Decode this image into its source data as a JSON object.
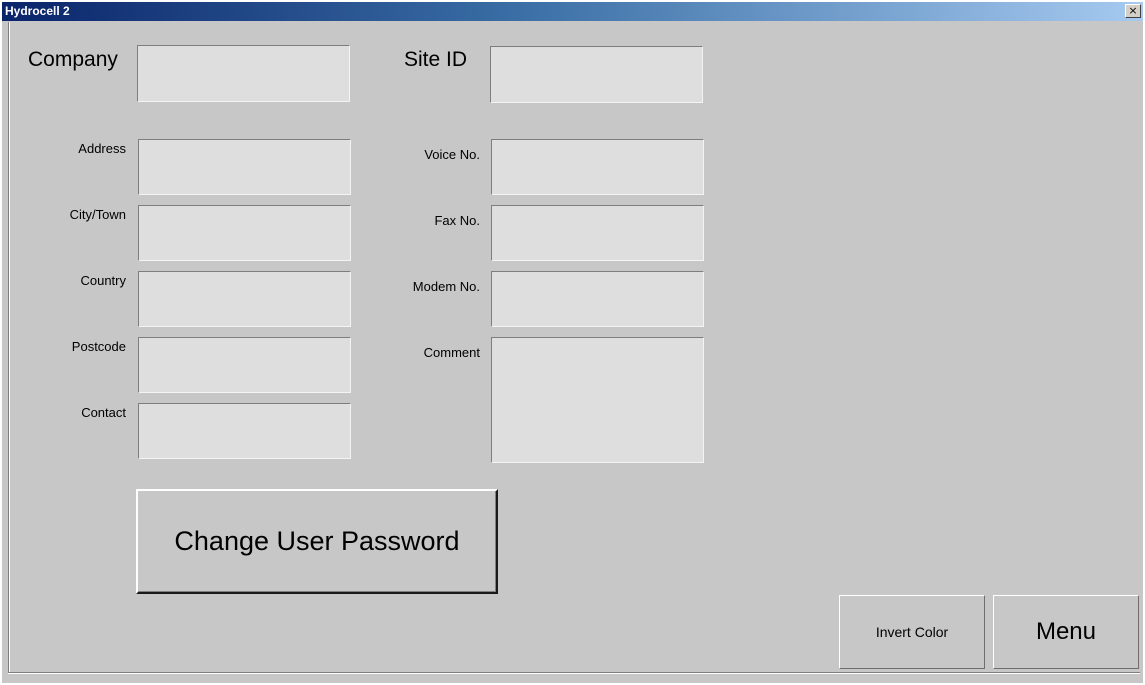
{
  "window": {
    "title": "Hydrocell 2",
    "close_glyph": "×"
  },
  "form": {
    "company_label": "Company",
    "company_value": "",
    "site_id_label": "Site ID",
    "site_id_value": "",
    "address_label": "Address",
    "address_value": "",
    "city_label": "City/Town",
    "city_value": "",
    "country_label": "Country",
    "country_value": "",
    "postcode_label": "Postcode",
    "postcode_value": "",
    "contact_label": "Contact",
    "contact_value": "",
    "voice_label": "Voice No.",
    "voice_value": "",
    "fax_label": "Fax No.",
    "fax_value": "",
    "modem_label": "Modem No.",
    "modem_value": "",
    "comment_label": "Comment",
    "comment_value": ""
  },
  "buttons": {
    "change_password": "Change User Password",
    "invert_color": "Invert Color",
    "menu": "Menu"
  },
  "colors": {
    "title_gradient_start": "#0a246a",
    "title_gradient_end": "#a6caf0",
    "window_bg": "#c7c7c7",
    "field_bg": "#dedede"
  }
}
